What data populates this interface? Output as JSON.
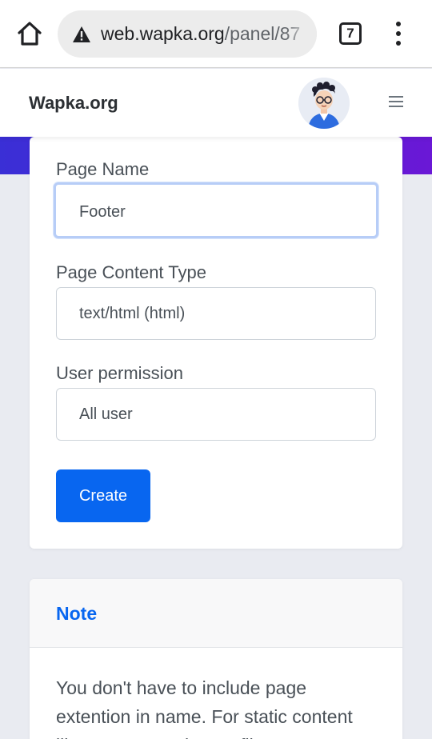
{
  "browser": {
    "url_host": "web.wapka.org",
    "url_path": "/panel/87",
    "tab_count": "7",
    "icons": [
      "home-icon",
      "warning-icon",
      "tab-switcher-icon",
      "more-vert-icon"
    ]
  },
  "header": {
    "brand": "Wapka.org",
    "icons": [
      "avatar",
      "hamburger-icon"
    ]
  },
  "form": {
    "page_name_label": "Page Name",
    "page_name_value": "Footer",
    "content_type_label": "Page Content Type",
    "content_type_value": "text/html (html)",
    "permission_label": "User permission",
    "permission_value": "All user",
    "submit_label": "Create"
  },
  "note": {
    "title": "Note",
    "body": "You don't have to include page extention in name. For static content like CSS, JS, robot.txt file"
  },
  "colors": {
    "accent": "#0866f0",
    "banner_start": "#3a2fd6",
    "banner_end": "#6a18d6",
    "focus_ring": "#b7cdf7"
  }
}
